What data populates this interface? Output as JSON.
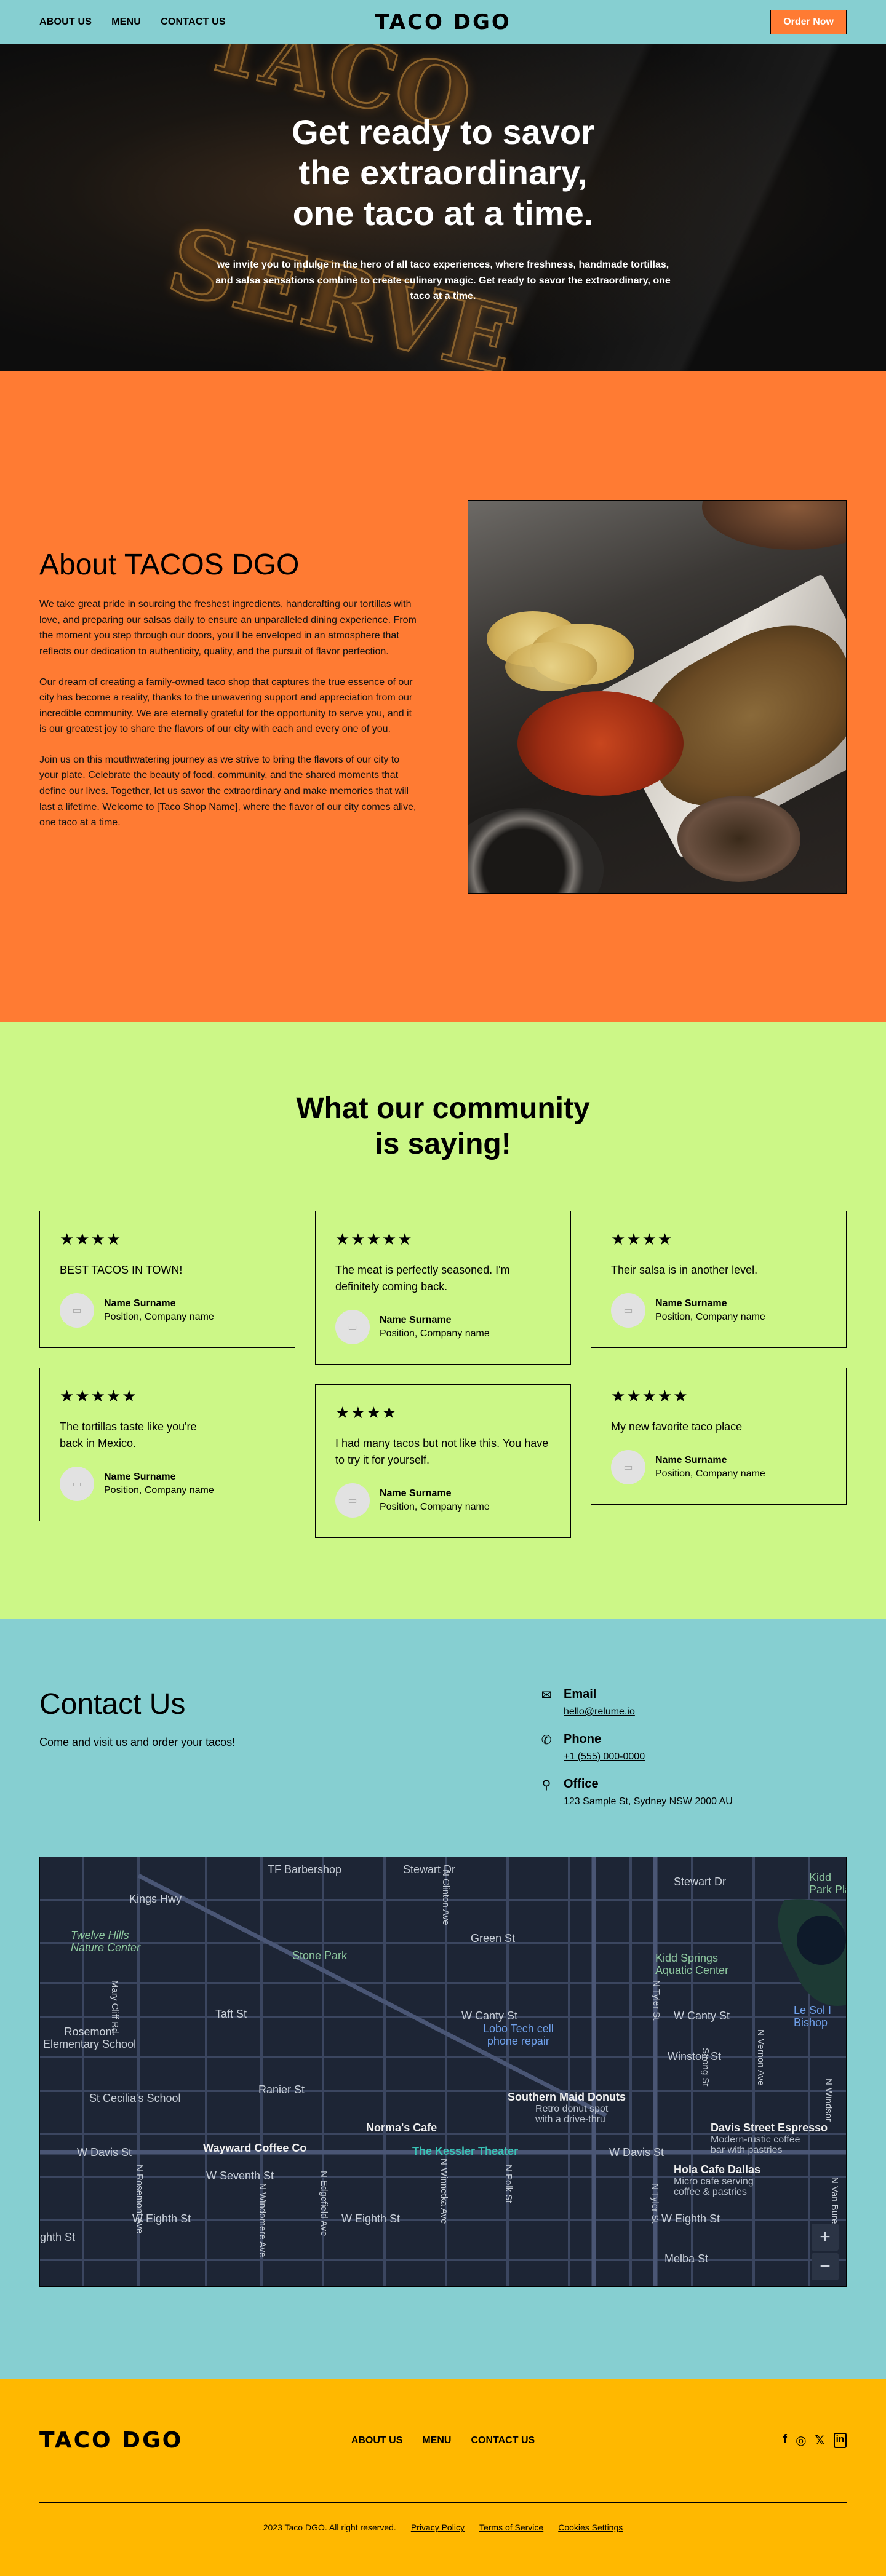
{
  "nav": {
    "links": [
      "ABOUT US",
      "MENU",
      "CONTACT US"
    ],
    "brand": "TACO DGO",
    "order_label": "Order Now"
  },
  "hero": {
    "title_lines": [
      "Get ready to savor",
      "the extraordinary,",
      "one taco at a time."
    ],
    "subtitle": "we invite you to indulge in the hero of all taco experiences, where freshness, handmade tortillas, and salsa sensations combine to create culinary magic. Get ready to savor the extraordinary, one taco at a time."
  },
  "about": {
    "title": "About TACOS DGO",
    "paragraphs": [
      "We take great pride in sourcing the freshest ingredients, handcrafting our tortillas with love, and preparing our salsas daily to ensure an unparalleled dining experience. From the moment you step through our doors, you'll be enveloped in an atmosphere that reflects our dedication to authenticity, quality, and the pursuit of flavor perfection.",
      "Our dream of creating a family-owned taco shop that captures the true essence of our city has become a reality, thanks to the unwavering support and appreciation from our incredible community. We are eternally grateful for the opportunity to serve you, and it is our greatest joy to share the flavors of our city with each and every one of you.",
      "Join us on this mouthwatering journey as we strive to bring the flavors of our city to your plate. Celebrate the beauty of food, community, and the shared moments that define our lives. Together, let us savor the extraordinary and make memories that will last a lifetime. Welcome to [Taco Shop Name], where the flavor of our city comes alive, one taco at a time."
    ]
  },
  "testimonials": {
    "title_lines": [
      "What our community",
      "is saying!"
    ],
    "columns": [
      [
        {
          "stars": "★★★★",
          "quote": "BEST TACOS IN TOWN!",
          "name": "Name Surname",
          "position": "Position, Company name"
        },
        {
          "stars": "★★★★★",
          "quote": "The tortillas taste like you're back in Mexico.",
          "name": "Name Surname",
          "position": "Position, Company name"
        }
      ],
      [
        {
          "stars": "★★★★★",
          "quote": "The meat is perfectly seasoned. I'm definitely coming back.",
          "name": "Name Surname",
          "position": "Position, Company name"
        },
        {
          "stars": "★★★★",
          "quote": "I had many tacos but not like this. You have to try it for yourself.",
          "name": "Name Surname",
          "position": "Position, Company name"
        }
      ],
      [
        {
          "stars": "★★★★",
          "quote": "Their salsa is in another level.",
          "name": "Name Surname",
          "position": "Position, Company name"
        },
        {
          "stars": "★★★★★",
          "quote": "My new favorite taco place",
          "name": "Name Surname",
          "position": "Position, Company name"
        }
      ]
    ]
  },
  "contact": {
    "title": "Contact Us",
    "subtitle": "Come and visit us and order your tacos!",
    "items": [
      {
        "icon": "email-icon",
        "label": "Email",
        "value": "hello@relume.io",
        "link": true
      },
      {
        "icon": "phone-icon",
        "label": "Phone",
        "value": "+1 (555) 000-0000",
        "link": true
      },
      {
        "icon": "location-pin-icon",
        "label": "Office",
        "value": "123 Sample St, Sydney NSW 2000 AU",
        "link": false
      }
    ]
  },
  "map": {
    "labels": {
      "tf_barbershop": "TF Barbershop",
      "stewart_dr": "Stewart Dr",
      "stewart_dr_2": "Stewart Dr",
      "kings_hwy": "Kings Hwy",
      "twelve_hills": "Twelve Hills\nNature Center",
      "green_st": "Green St",
      "stone_park": "Stone Park",
      "kidd_springs": "Kidd Springs\nAquatic Center",
      "kidd_park": "Kidd\nPark Pla",
      "taft_st": "Taft St",
      "w_canty_st": "W Canty St",
      "w_canty_st_2": "W Canty St",
      "le_sol": "Le Sol I\nBishop",
      "rosemont": "Rosemont\nElementary School",
      "lobo_tech": "Lobo Tech cell\nphone repair",
      "winston_st": "Winston St",
      "ranier_st": "Ranier St",
      "st_cecilia": "St Cecilia's School",
      "southern_maid": "Southern Maid Donuts",
      "southern_maid_sub": "Retro donut spot\nwith a drive-thru",
      "norma": "Norma's Cafe",
      "davis_espresso": "Davis Street Espresso",
      "davis_espresso_sub": "Modern-rustic coffee\nbar with pastries",
      "w_davis_st": "W Davis St",
      "w_davis_st_2": "W Davis St",
      "wayward": "Wayward Coffee Co",
      "kessler": "The Kessler Theater",
      "hola_cafe": "Hola Cafe Dallas",
      "hola_cafe_sub": "Micro cafe serving\ncoffee & pastries",
      "w_seventh": "W Seventh St",
      "w_eighth": "W Eighth St",
      "w_eighth_2": "W Eighth St",
      "w_eighth_3": "W Eighth St",
      "eighth": "ghth St",
      "melba_st": "Melba St",
      "n_clinton": "N Clinton Ave",
      "n_tyler": "N Tyler St",
      "n_tyler_2": "N Tyler St",
      "mary_cliff": "Mary Cliff Rd",
      "n_rosemont": "N Rosemont Ave",
      "n_windomere": "N Windomere Ave",
      "n_edgefield": "N Edgefield Ave",
      "n_winnetka": "N Winnetka Ave",
      "n_polk": "N Polk St",
      "n_van_buren": "N Van Buren",
      "strong_st": "Strong St",
      "n_vernon": "N Vernon Ave",
      "n_windsor": "N Windsor"
    },
    "zoom_in": "+",
    "zoom_out": "−"
  },
  "footer": {
    "brand": "TACO DGO",
    "links": [
      "ABOUT US",
      "MENU",
      "CONTACT US"
    ],
    "social": [
      "facebook-icon",
      "instagram-icon",
      "x-icon",
      "linkedin-icon"
    ],
    "copyright": "2023 Taco DGO. All right reserved.",
    "legal": [
      "Privacy Policy",
      "Terms of Service",
      "Cookies Settings"
    ]
  },
  "colors": {
    "nav_bg": "#86cfd1",
    "accent_orange": "#ff7b33",
    "testimonial_bg": "#ccf787",
    "footer_bg": "#ffb800",
    "map_bg": "#1d2535"
  }
}
